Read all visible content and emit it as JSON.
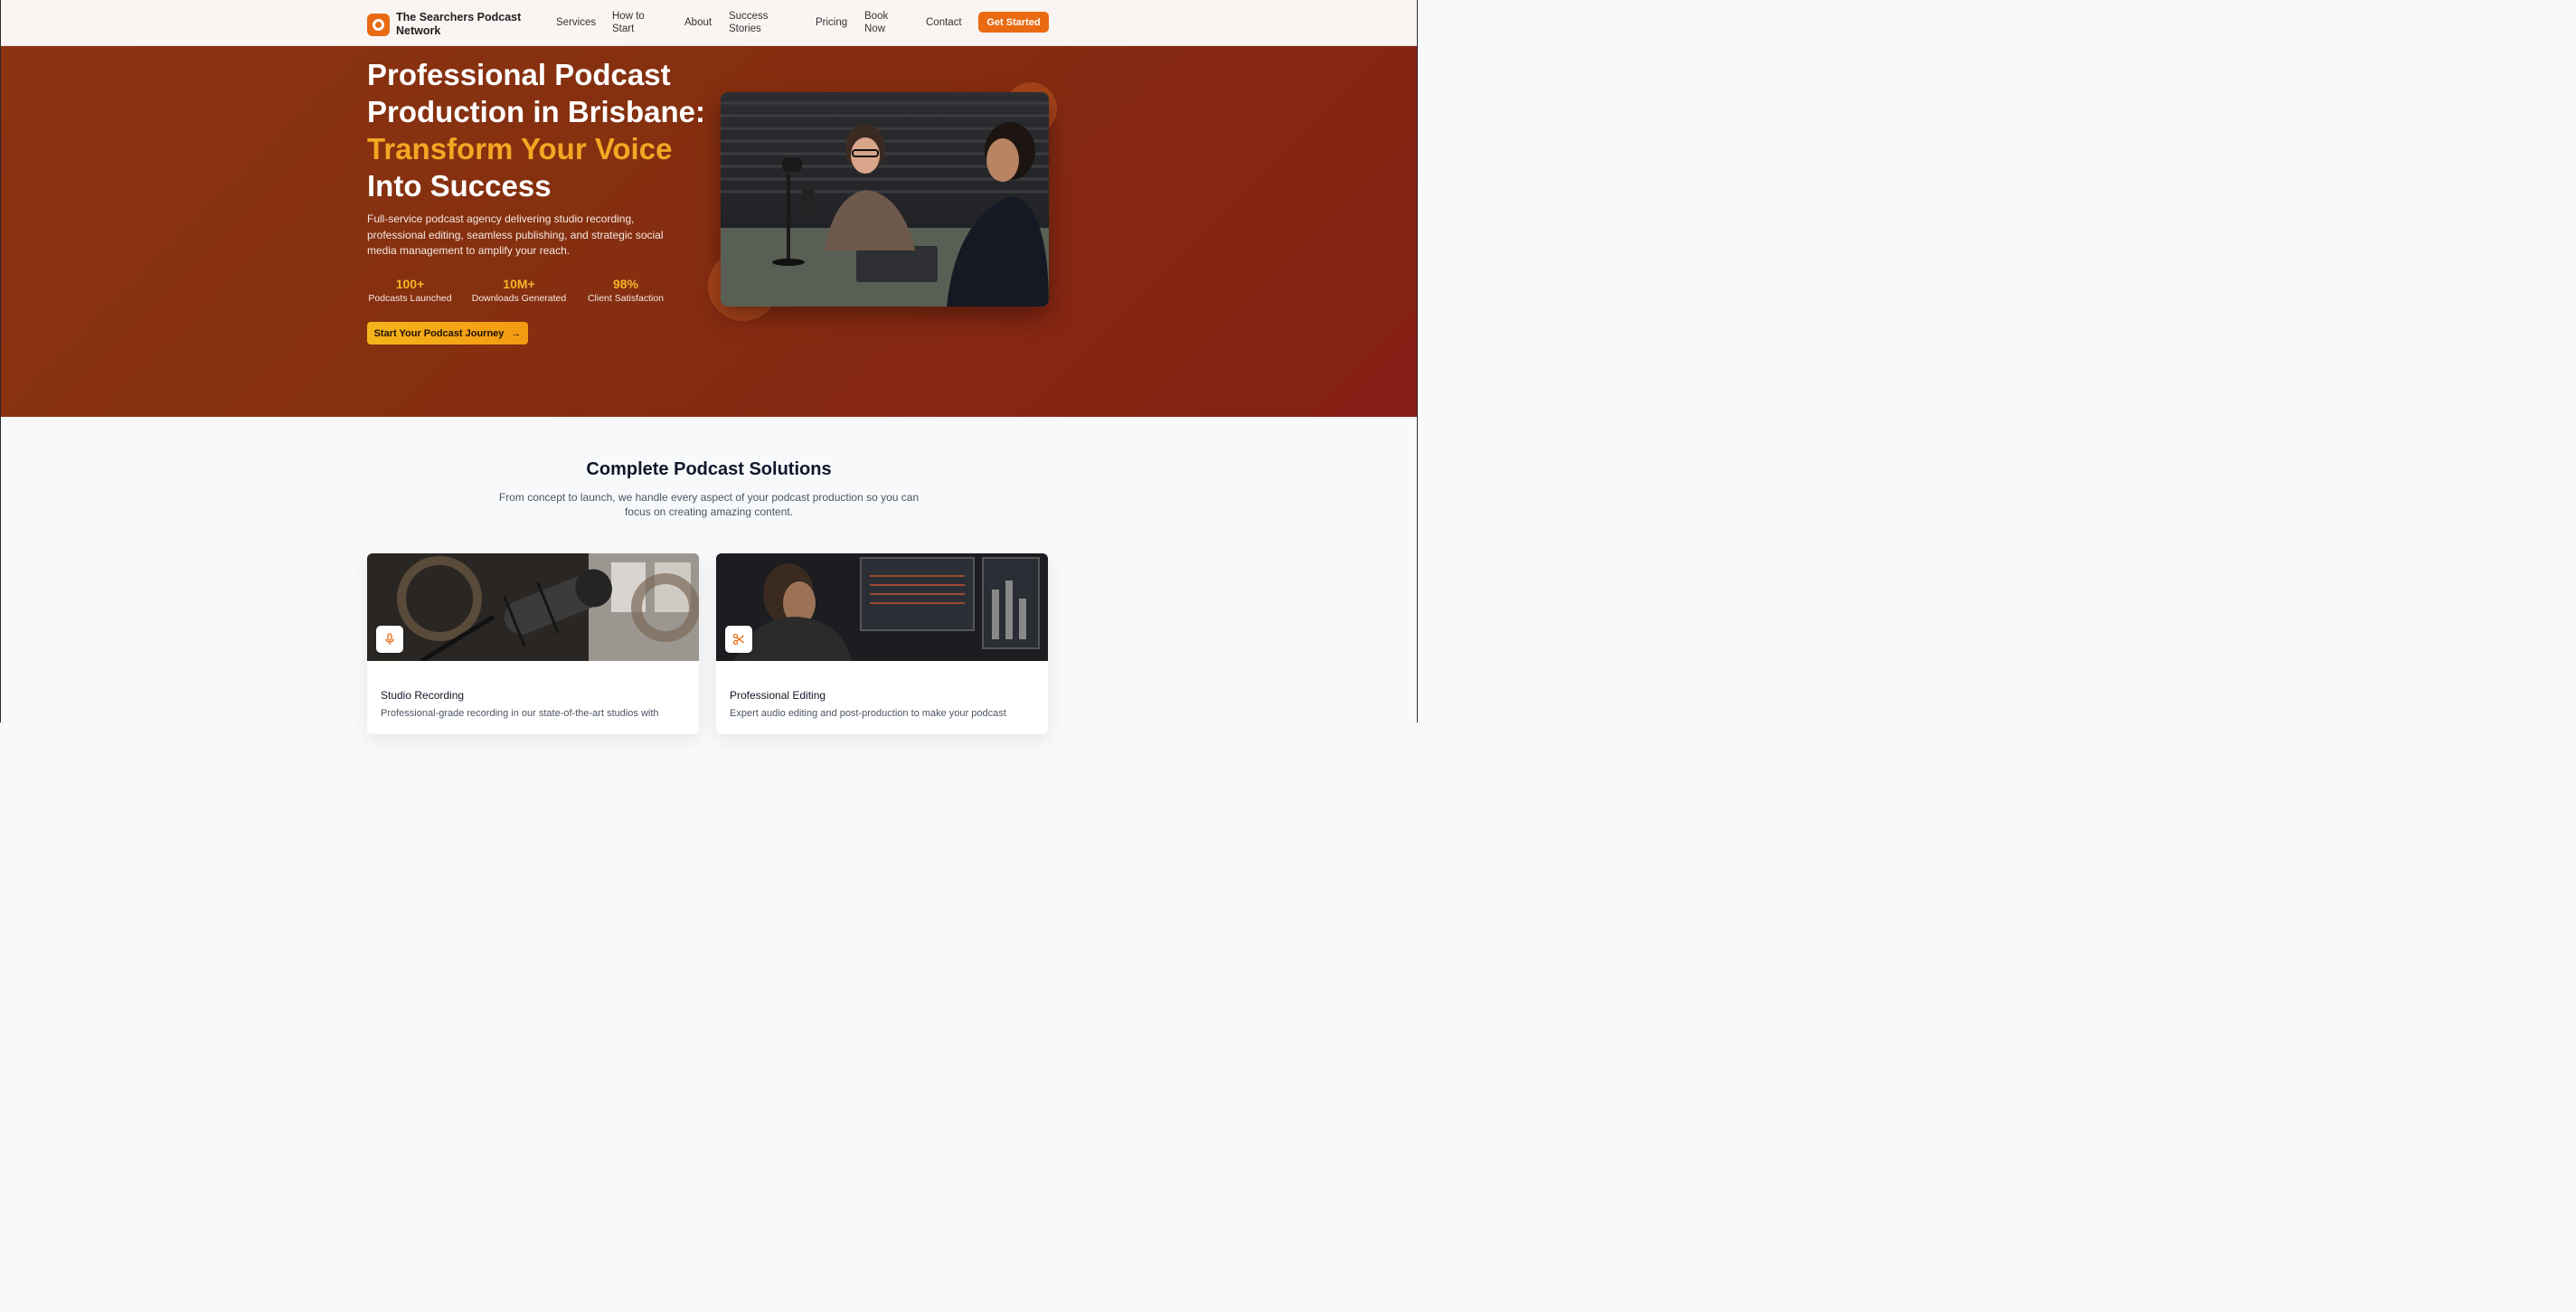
{
  "nav": {
    "brand": "The Searchers Podcast Network",
    "links": [
      "Services",
      "How to Start",
      "About",
      "Success Stories",
      "Pricing",
      "Book Now",
      "Contact"
    ],
    "cta": "Get Started"
  },
  "hero": {
    "title_line1": "Professional Podcast",
    "title_line2": "Production in Brisbane:",
    "title_accent": "Transform Your Voice",
    "title_line4": "Into Success",
    "description": "Full-service podcast agency delivering studio recording, professional editing, seamless publishing, and strategic social media management to amplify your reach.",
    "stats": [
      {
        "value": "100+",
        "label": "Podcasts Launched"
      },
      {
        "value": "10M+",
        "label": "Downloads Generated"
      },
      {
        "value": "98%",
        "label": "Client Satisfaction"
      }
    ],
    "button": "Start Your Podcast Journey",
    "button_icon": "arrow-right-icon"
  },
  "solutions": {
    "title": "Complete Podcast Solutions",
    "subtitle": "From concept to launch, we handle every aspect of your podcast production so you can focus on creating amazing content.",
    "cards": [
      {
        "icon": "microphone-icon",
        "title": "Studio Recording",
        "desc": "Professional-grade recording in our state-of-the-art studios with"
      },
      {
        "icon": "scissors-icon",
        "title": "Professional Editing",
        "desc": "Expert audio editing and post-production to make your podcast"
      }
    ]
  },
  "colors": {
    "accent": "#ea6a12",
    "hero_bg": "#8a3312",
    "highlight": "#f5a623"
  }
}
